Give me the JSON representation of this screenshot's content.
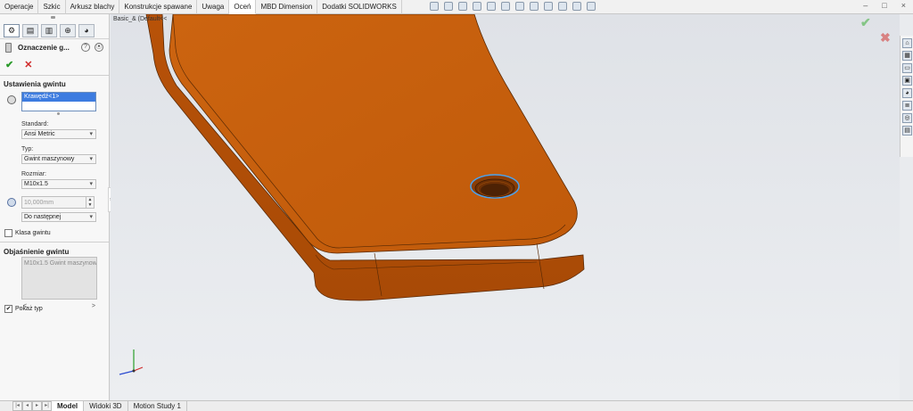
{
  "tabs": [
    {
      "label": "Operacje"
    },
    {
      "label": "Szkic"
    },
    {
      "label": "Arkusz blachy"
    },
    {
      "label": "Konstrukcje spawane"
    },
    {
      "label": "Uwaga"
    },
    {
      "label": "Oceń"
    },
    {
      "label": "MBD Dimension"
    },
    {
      "label": "Dodatki SOLIDWORKS"
    }
  ],
  "active_tab": "Oceń",
  "window_controls": {
    "minimize": "–",
    "restore": "□",
    "close": "×"
  },
  "property_manager": {
    "title": "Oznaczenie g...",
    "help": "?",
    "pin": "⦿",
    "ok_symbol": "✔",
    "cancel_symbol": "✕",
    "section_thread_settings": "Ustawienia gwintu",
    "selection_item": "Krawędź<1>",
    "standard_label": "Standard:",
    "standard_value": "Ansi Metric",
    "type_label": "Typ:",
    "type_value": "Gwint maszynowy",
    "size_label": "Rozmiar:",
    "size_value": "M10x1.5",
    "depth_value": "10,000mm",
    "end_condition_value": "Do następnej",
    "thread_class_label": "Klasa gwintu",
    "section_callout": "Objaśnienie gwintu",
    "callout_text": "M10x1.5 Gwint maszynow",
    "show_type_label": "Pokaż typ",
    "show_type_checked": "✔",
    "scroll_left": "<",
    "scroll_right": ">",
    "expand_handle": "»"
  },
  "graphics": {
    "breadcrumb": "Basic_& (Default<<",
    "confirm_ok": "✔",
    "confirm_cancel": "✖",
    "model_color": "#c55a0c"
  },
  "task_pane_icons": [
    "home-icon",
    "resources-icon",
    "folder-icon",
    "view-palette-icon",
    "appearance-icon",
    "custom-properties-icon",
    "forum-icon",
    "shortcut-icon"
  ],
  "bottom_tabs": [
    {
      "label": "Model"
    },
    {
      "label": "Widoki 3D"
    },
    {
      "label": "Motion Study 1"
    }
  ],
  "active_bottom_tab": "Model",
  "nav_arrows": [
    "|◂",
    "◂",
    "▸",
    "▸|"
  ]
}
